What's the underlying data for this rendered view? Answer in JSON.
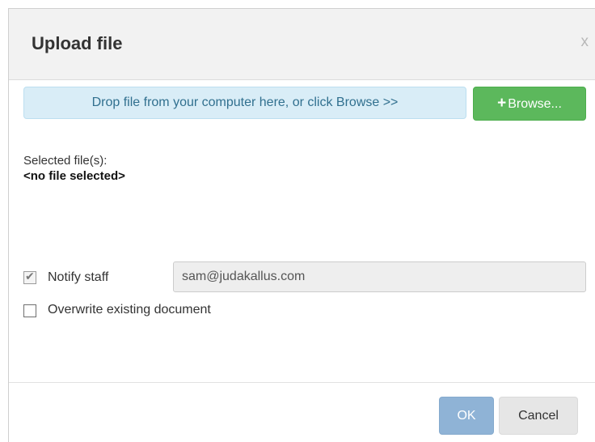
{
  "dialog": {
    "title": "Upload file",
    "close_label": "x"
  },
  "upload": {
    "dropzone_text": "Drop file from your computer here, or click Browse >>",
    "browse_icon": "+",
    "browse_label": "Browse..."
  },
  "selection": {
    "label": "Selected file(s):",
    "value": "<no file selected>"
  },
  "options": {
    "notify_label": "Notify staff",
    "notify_checked": true,
    "notify_email": "sam@judakallus.com",
    "overwrite_label": "Overwrite existing document",
    "overwrite_checked": false
  },
  "footer": {
    "ok_label": "OK",
    "cancel_label": "Cancel"
  },
  "colors": {
    "browse_button": "#5cb85c",
    "dropzone_background": "#d9edf7",
    "ok_button": "#8fb3d6"
  }
}
